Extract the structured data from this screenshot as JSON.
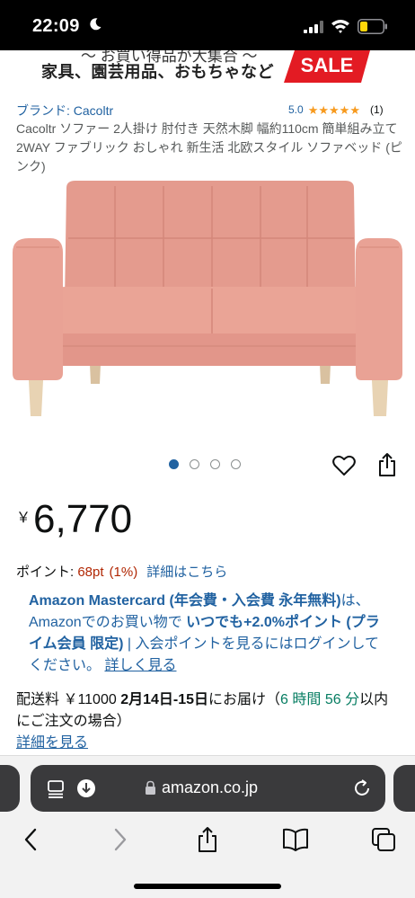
{
  "status_bar": {
    "time": "22:09"
  },
  "banner": {
    "top_text": "〜 お買い得品が大集合 〜",
    "main_text": "家具、園芸用品、おもちゃなど",
    "sale_label": "SALE"
  },
  "product": {
    "brand": "ブランド: Cacoltr",
    "rating_value": "5.0",
    "rating_count": "(1)",
    "title": "Cacoltr ソファー 2人掛け 肘付き 天然木脚 幅約110cm 簡単組み立て 2WAY ファブリック おしゃれ 新生活 北欧スタイル ソファベッド (ピンク)",
    "image_count": 4,
    "active_image": 1
  },
  "price": {
    "symbol": "￥",
    "value": "6,770"
  },
  "points": {
    "label": "ポイント: ",
    "pt": "68pt",
    "pct": "(1%)",
    "link": "詳細はこちら"
  },
  "promo": {
    "part1": "Amazon Mastercard (年会費・入会費 永年無料)",
    "part2": "は、Amazonでのお買い物で ",
    "part3": "いつでも+2.0%ポイント (プライム会員 限定)",
    "part4": " | 入会ポイントを見るにはログインしてください。 ",
    "link": "詳しく見る"
  },
  "delivery": {
    "shipping": "配送料 ￥11000  ",
    "date": "2月14日-15日",
    "arrive": "にお届け（",
    "deadline": "6 時間 56 分",
    "order_note": "以内にご注文の場合）",
    "details_link": "詳細を見る"
  },
  "browser": {
    "url": "amazon.co.jp"
  },
  "colors": {
    "link": "#2162a1",
    "price_red": "#b12704",
    "green": "#067d62",
    "star": "#f79a1e",
    "sale_red": "#e31b23",
    "sofa_pink": "#e49b8e"
  }
}
